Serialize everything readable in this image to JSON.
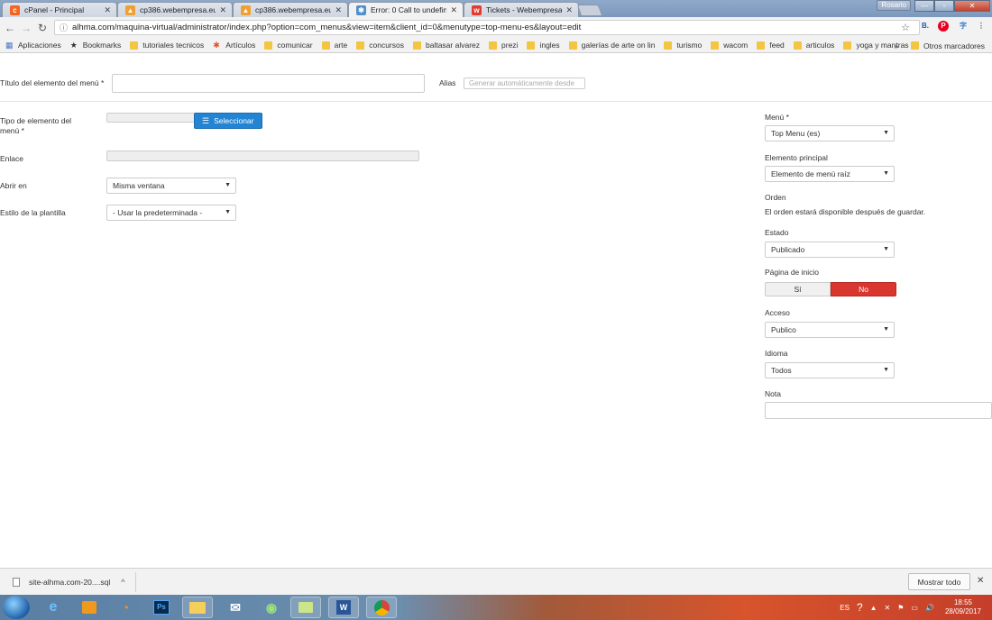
{
  "browser": {
    "tabs": [
      {
        "title": "cPanel - Principal",
        "favicon": "cpanel-icon",
        "color": "#f26522",
        "active": false
      },
      {
        "title": "cp386.webempresa.eu / l",
        "favicon": "phpmyadmin-icon",
        "color": "#f0a030",
        "active": false
      },
      {
        "title": "cp386.webempresa.eu / l",
        "favicon": "phpmyadmin-icon",
        "color": "#f0a030",
        "active": false
      },
      {
        "title": "Error: 0 Call to undefined",
        "favicon": "joomla-icon",
        "color": "#5091cd",
        "active": true
      },
      {
        "title": "Tickets - Webempresa E",
        "favicon": "webempresa-icon",
        "color": "#e33b2e",
        "active": false
      }
    ],
    "user_label": "Rosario",
    "url": "alhma.com/maquina-virtual/administrator/index.php?option=com_menus&view=item&client_id=0&menutype=top-menu-es&layout=edit",
    "bookmarks": [
      {
        "label": "Aplicaciones",
        "type": "apps"
      },
      {
        "label": "Bookmarks",
        "type": "star"
      },
      {
        "label": "tutoriales tecnicos",
        "type": "folder"
      },
      {
        "label": "Artículos",
        "type": "joomla"
      },
      {
        "label": "comunicar",
        "type": "folder"
      },
      {
        "label": "arte",
        "type": "folder"
      },
      {
        "label": "concursos",
        "type": "folder"
      },
      {
        "label": "baltasar alvarez",
        "type": "folder"
      },
      {
        "label": "prezi",
        "type": "folder"
      },
      {
        "label": "ingles",
        "type": "folder"
      },
      {
        "label": "galerías de arte on lin",
        "type": "folder"
      },
      {
        "label": "turismo",
        "type": "folder"
      },
      {
        "label": "wacom",
        "type": "folder"
      },
      {
        "label": "feed",
        "type": "folder"
      },
      {
        "label": "articulos",
        "type": "folder"
      },
      {
        "label": "yoga y mantras",
        "type": "folder"
      }
    ],
    "bookmarks_overflow": "»",
    "other_bookmarks": "Otros marcadores"
  },
  "form": {
    "title_label": "Título del elemento del menú *",
    "title_value": "",
    "alias_label": "Alias",
    "alias_placeholder": "Generar automáticamente desde",
    "type_label": "Tipo de elemento del menú *",
    "select_button": "Seleccionar",
    "link_label": "Enlace",
    "open_in_label": "Abrir en",
    "open_in_value": "Misma ventana",
    "template_style_label": "Estilo de la plantilla",
    "template_style_value": "- Usar la predeterminada -"
  },
  "sidebar": {
    "menu_label": "Menú *",
    "menu_value": "Top Menu (es)",
    "parent_label": "Elemento principal",
    "parent_value": "Elemento de menú raíz",
    "order_label": "Orden",
    "order_text": "El orden estará disponible después de guardar.",
    "status_label": "Estado",
    "status_value": "Publicado",
    "home_label": "Página de inicio",
    "home_yes": "Sí",
    "home_no": "No",
    "access_label": "Acceso",
    "access_value": "Publico",
    "language_label": "Idioma",
    "language_value": "Todos",
    "note_label": "Nota",
    "note_value": ""
  },
  "downloads": {
    "file_name": "site-alhma.com-20....sql",
    "show_all": "Mostrar todo"
  },
  "taskbar": {
    "language": "ES",
    "time": "18:55",
    "date": "28/09/2017"
  },
  "colors": {
    "primary": "#2384d3",
    "danger": "#d9362f"
  }
}
